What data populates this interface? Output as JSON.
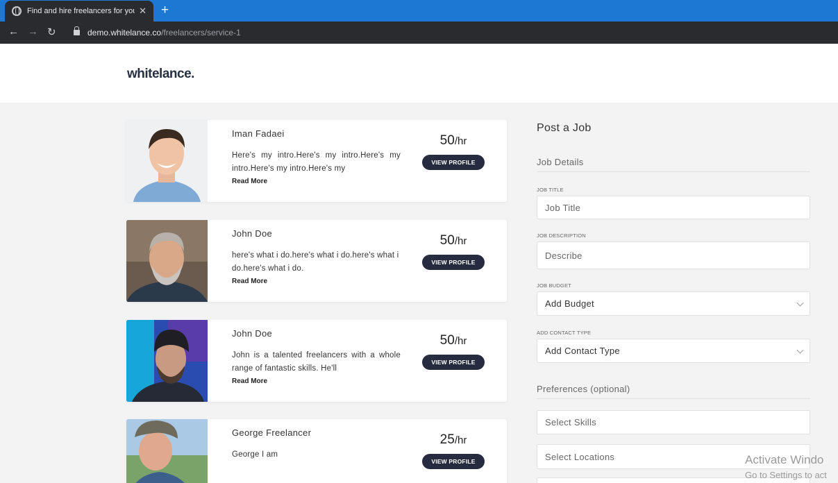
{
  "browser": {
    "tab_title": "Find and hire freelancers for you",
    "url_host": "demo.whitelance.co",
    "url_path": "/freelancers/service-1"
  },
  "site": {
    "logo": "whitelance."
  },
  "freelancers": [
    {
      "name": "Iman Fadaei",
      "bio": "Here's my intro.Here's my intro.Here's my intro.Here's my intro.Here's my",
      "rate": "50",
      "unit": "/hr",
      "read_more": "Read More",
      "view_label": "VIEW PROFILE"
    },
    {
      "name": "John Doe",
      "bio": "here's what i do.here's what i do.here's what i do.here's what i do.",
      "rate": "50",
      "unit": "/hr",
      "read_more": "Read More",
      "view_label": "VIEW PROFILE"
    },
    {
      "name": "John Doe",
      "bio": "John is a talented freelancers with a whole range of fantastic skills. He'll",
      "rate": "50",
      "unit": "/hr",
      "read_more": "Read More",
      "view_label": "VIEW PROFILE"
    },
    {
      "name": "George Freelancer",
      "bio": "George I am",
      "rate": "25",
      "unit": "/hr",
      "read_more": "",
      "view_label": "VIEW PROFILE"
    }
  ],
  "post_job": {
    "title": "Post a Job",
    "job_details": "Job Details",
    "job_title_label": "JOB TITLE",
    "job_title_placeholder": "Job Title",
    "job_description_label": "JOB DESCRIPTION",
    "job_description_placeholder": "Describe",
    "job_budget_label": "JOB BUDGET",
    "budget_selected": "Add Budget",
    "contact_type_label": "ADD CONTACT TYPE",
    "contact_type_selected": "Add Contact Type",
    "preferences": "Preferences (optional)",
    "skills_placeholder": "Select Skills",
    "locations_placeholder": "Select Locations"
  },
  "watermark": {
    "line1": "Activate Windo",
    "line2": "Go to Settings to act"
  }
}
